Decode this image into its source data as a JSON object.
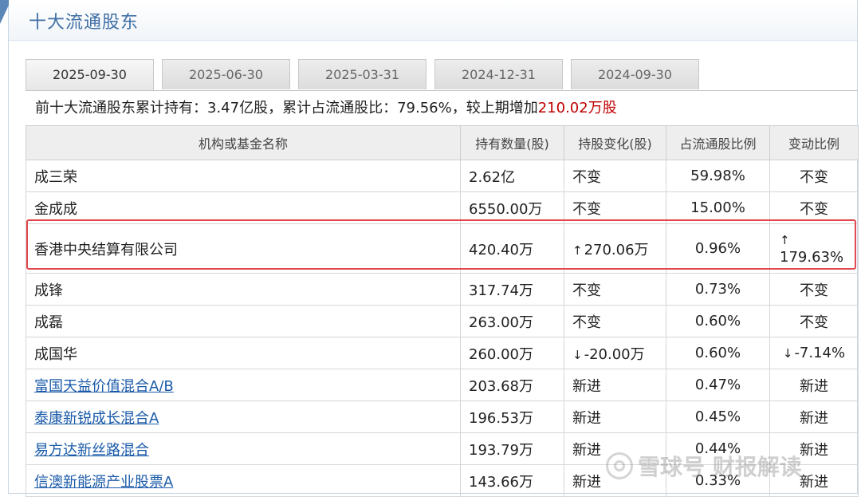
{
  "title": "十大流通股东",
  "tabs": [
    {
      "label": "2025-09-30",
      "active": true
    },
    {
      "label": "2025-06-30",
      "active": false
    },
    {
      "label": "2025-03-31",
      "active": false
    },
    {
      "label": "2024-12-31",
      "active": false
    },
    {
      "label": "2024-09-30",
      "active": false
    }
  ],
  "summary": {
    "prefix": "前十大流通股东累计持有：3.47亿股，累计占流通股比：79.56%，较上期增加",
    "change": "210.02万股"
  },
  "table": {
    "headers": [
      "机构或基金名称",
      "持有数量(股)",
      "持股变化(股)",
      "占流通股比例",
      "变动比例"
    ],
    "rows": [
      {
        "name": "成三荣",
        "shares": "2.62亿",
        "change": "不变",
        "ratio": "59.98%",
        "change_ratio": "不变"
      },
      {
        "name": "金成成",
        "shares": "6550.00万",
        "change": "不变",
        "ratio": "15.00%",
        "change_ratio": "不变"
      },
      {
        "name": "香港中央结算有限公司",
        "shares": "420.40万",
        "change": "270.06万",
        "ratio": "0.96%",
        "change_ratio": "179.63%"
      },
      {
        "name": "成锋",
        "shares": "317.74万",
        "change": "不变",
        "ratio": "0.73%",
        "change_ratio": "不变"
      },
      {
        "name": "成磊",
        "shares": "263.00万",
        "change": "不变",
        "ratio": "0.60%",
        "change_ratio": "不变"
      },
      {
        "name": "成国华",
        "shares": "260.00万",
        "change": "-20.00万",
        "ratio": "0.60%",
        "change_ratio": "-7.14%"
      },
      {
        "name": "富国天益价值混合A/B",
        "shares": "203.68万",
        "change": "新进",
        "ratio": "0.47%",
        "change_ratio": "新进"
      },
      {
        "name": "泰康新锐成长混合A",
        "shares": "196.53万",
        "change": "新进",
        "ratio": "0.45%",
        "change_ratio": "新进"
      },
      {
        "name": "易方达新丝路混合",
        "shares": "193.79万",
        "change": "新进",
        "ratio": "0.44%",
        "change_ratio": "新进"
      },
      {
        "name": "信澳新能源产业股票A",
        "shares": "143.66万",
        "change": "新进",
        "ratio": "0.33%",
        "change_ratio": "新进"
      }
    ]
  },
  "icons": {
    "up": "↑",
    "down": "↓"
  },
  "colors": {
    "up": "#d01010",
    "down": "#1a8a1a",
    "link": "#1a5aa8",
    "highlight_border": "#e0474f",
    "title": "#3f6fa5"
  },
  "watermark": {
    "text": "雪球号 财报解读"
  }
}
